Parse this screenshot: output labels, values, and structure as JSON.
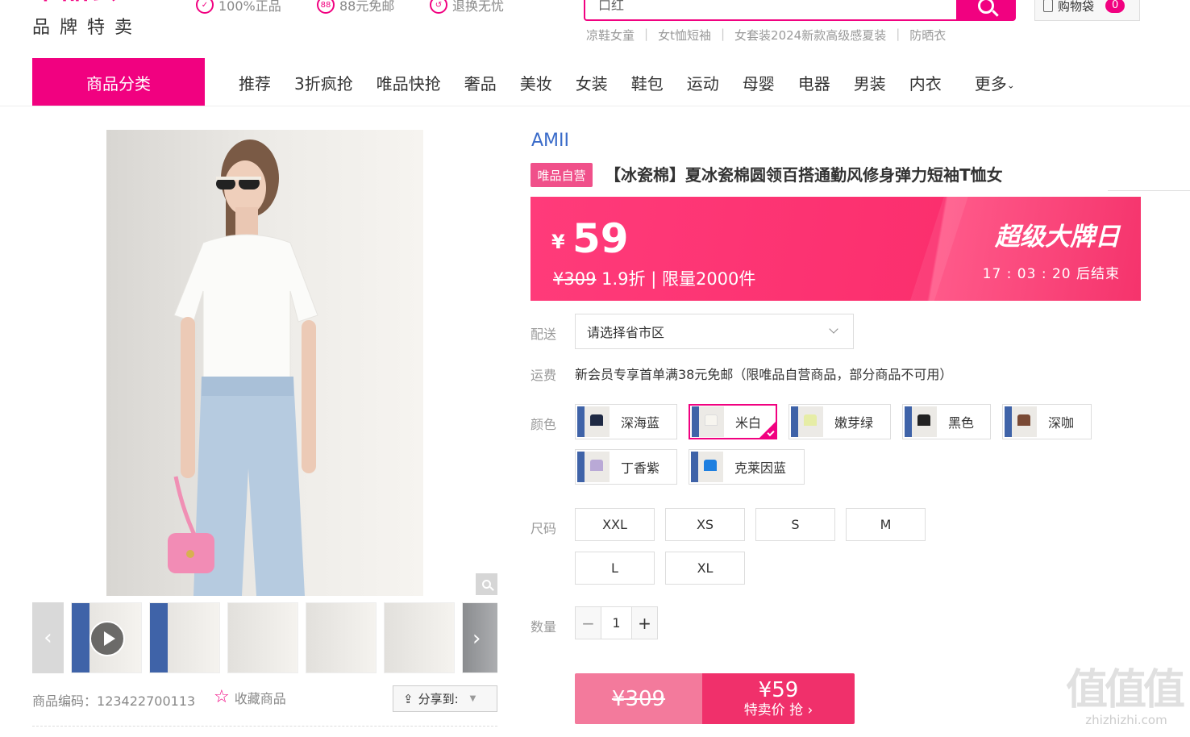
{
  "header": {
    "logo_sub": "品牌特卖",
    "promises": [
      "100%正品",
      "88元免邮",
      "退换无忧"
    ],
    "promise_icons": [
      "shield-check-icon",
      "88-badge-icon",
      "return-icon"
    ],
    "search": {
      "value": "口红"
    },
    "hot_words": [
      "凉鞋女童",
      "女t恤短袖",
      "女套装2024新款高级感夏装",
      "防晒衣"
    ],
    "cart": {
      "label": "购物袋",
      "count": "0"
    }
  },
  "nav": {
    "category_label": "商品分类",
    "items": [
      "推荐",
      "3折疯抢",
      "唯品快抢",
      "奢品",
      "美妆",
      "女装",
      "鞋包",
      "运动",
      "母婴",
      "电器",
      "男装",
      "内衣",
      "更多"
    ]
  },
  "gallery": {
    "product_code_label": "商品编码：",
    "product_code": "123422700113",
    "favorite_label": "收藏商品",
    "share_label": "分享到:"
  },
  "product": {
    "brand": "AMII",
    "badge": "唯品自营",
    "title": "【冰瓷棉】夏冰瓷棉圆领百搭通勤风修身弹力短袖T恤女",
    "currency": "¥",
    "price": "59",
    "original_price": "¥309",
    "discount_text": "1.9折 | 限量2000件",
    "event_title": "超级大牌日",
    "countdown": "17 : 03 : 20",
    "countdown_suffix": "后结束",
    "accent_color": "#f10180"
  },
  "options": {
    "delivery_label": "配送",
    "delivery_placeholder": "请选择省市区",
    "shipping_label": "运费",
    "shipping_text": "新会员专享首单满38元免邮（限唯品自营商品，部分商品不可用）",
    "color_label": "颜色",
    "colors": [
      {
        "name": "深海蓝",
        "tee": "#1f2a44"
      },
      {
        "name": "米白",
        "tee": "#f7f5ef"
      },
      {
        "name": "嫩芽绿",
        "tee": "#e6eda6"
      },
      {
        "name": "黑色",
        "tee": "#222222"
      },
      {
        "name": "深咖",
        "tee": "#7a4a35"
      },
      {
        "name": "丁香紫",
        "tee": "#b9a9d6"
      },
      {
        "name": "克莱因蓝",
        "tee": "#1e7fe0"
      }
    ],
    "selected_color": "米白",
    "size_label": "尺码",
    "sizes": [
      "XXL",
      "XS",
      "S",
      "M",
      "L",
      "XL"
    ],
    "quantity_label": "数量",
    "quantity": "1"
  },
  "buy": {
    "original": "¥309",
    "price": "¥59",
    "action": "特卖价 抢"
  },
  "watermark": {
    "text": "值值值",
    "site": "zhizhizhi.com"
  }
}
